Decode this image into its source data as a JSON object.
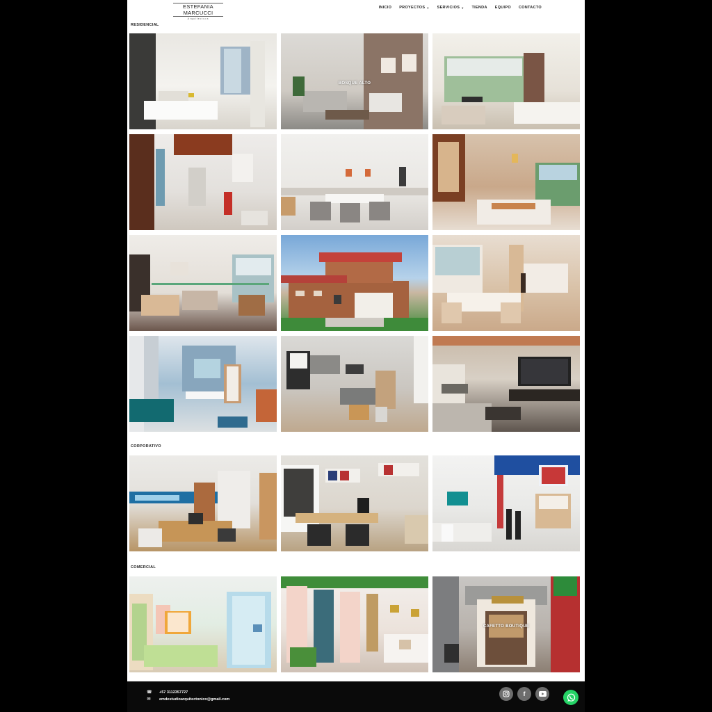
{
  "header": {
    "logo_name": "ESTEFANIA MARCUCCI",
    "logo_sub": "Arquitectura",
    "nav": [
      {
        "label": "INICIO",
        "dropdown": false
      },
      {
        "label": "PROYECTOS",
        "dropdown": true
      },
      {
        "label": "SERVICIOS",
        "dropdown": true
      },
      {
        "label": "TIENDA",
        "dropdown": false
      },
      {
        "label": "EQUIPO",
        "dropdown": false
      },
      {
        "label": "CONTACTO",
        "dropdown": false
      }
    ]
  },
  "sections": [
    {
      "title": "RESIDENCIAL",
      "tiles": [
        {
          "caption": "",
          "theme": "kitchen-white"
        },
        {
          "caption": "BOSQUE ALTO",
          "theme": "living-grey"
        },
        {
          "caption": "",
          "theme": "living-window"
        },
        {
          "caption": "",
          "theme": "hallway-wood"
        },
        {
          "caption": "",
          "theme": "dining-white"
        },
        {
          "caption": "",
          "theme": "dining-warm"
        },
        {
          "caption": "",
          "theme": "living-beige"
        },
        {
          "caption": "",
          "theme": "house-exterior"
        },
        {
          "caption": "",
          "theme": "dining-gold"
        },
        {
          "caption": "",
          "theme": "dining-blue"
        },
        {
          "caption": "",
          "theme": "living-teal"
        },
        {
          "caption": "",
          "theme": "living-tv"
        }
      ]
    },
    {
      "title": "CORPORATIVO",
      "tiles": [
        {
          "caption": "",
          "theme": "office-wood"
        },
        {
          "caption": "",
          "theme": "office-brick"
        },
        {
          "caption": "",
          "theme": "office-blue"
        }
      ]
    },
    {
      "title": "COMERCIAL",
      "tiles": [
        {
          "caption": "",
          "theme": "shop-pastel"
        },
        {
          "caption": "",
          "theme": "shop-arches"
        },
        {
          "caption": "CAFETTO BOUTIQUE",
          "theme": "shop-facade"
        }
      ]
    }
  ],
  "footer": {
    "phone": "+57 3112357727",
    "email": "emdestudioarquitectonico@gmail.com",
    "phone_icon": "phone-icon",
    "email_icon": "mail-icon",
    "social": [
      "instagram-icon",
      "facebook-icon",
      "youtube-icon"
    ],
    "whatsapp_icon": "whatsapp-icon"
  },
  "colors": {
    "page_bg": "#000000",
    "content_bg": "#ffffff",
    "footer_bg": "#0a0a0a",
    "social_bg": "#6d6d6d",
    "whatsapp": "#25d366"
  }
}
